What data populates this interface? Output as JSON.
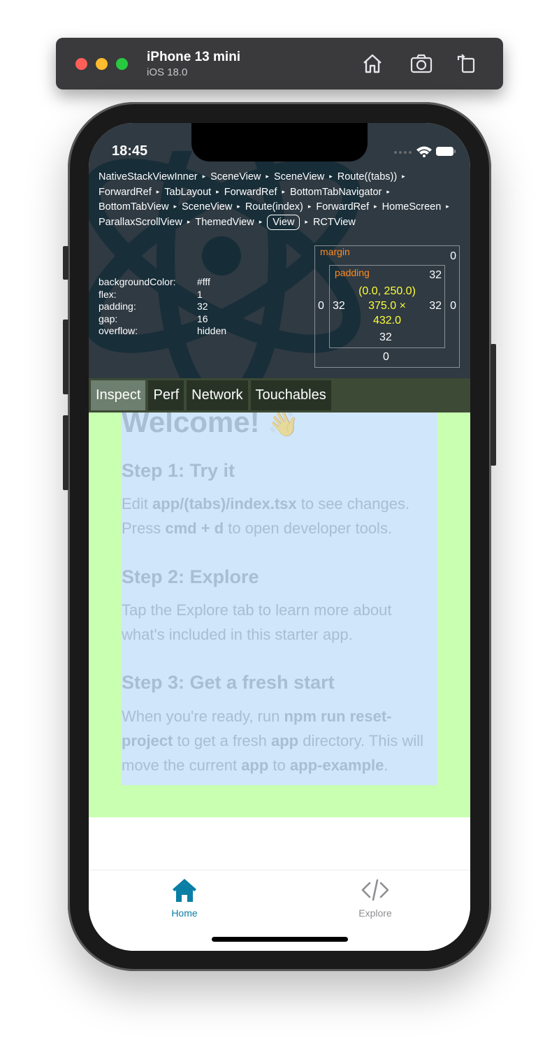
{
  "simulator": {
    "device_name": "iPhone 13 mini",
    "os_version": "iOS 18.0"
  },
  "status_bar": {
    "time": "18:45"
  },
  "inspector": {
    "breadcrumbs": [
      "NativeStackViewInner",
      "SceneView",
      "SceneView",
      "Route((tabs))",
      "ForwardRef",
      "TabLayout",
      "ForwardRef",
      "BottomTabNavigator",
      "BottomTabView",
      "SceneView",
      "Route(index)",
      "ForwardRef",
      "HomeScreen",
      "ParallaxScrollView",
      "ThemedView",
      "View",
      "RCTView"
    ],
    "selected_crumb": "View",
    "props": [
      {
        "key": "backgroundColor:",
        "value": "#fff"
      },
      {
        "key": "flex:",
        "value": "1"
      },
      {
        "key": "padding:",
        "value": "32"
      },
      {
        "key": "gap:",
        "value": "16"
      },
      {
        "key": "overflow:",
        "value": "hidden"
      }
    ],
    "box_model": {
      "margin_label": "margin",
      "padding_label": "padding",
      "margin_top": "0",
      "margin_left": "0",
      "margin_right": "0",
      "margin_bottom": "0",
      "padding_top": "32",
      "padding_left": "32",
      "padding_right": "32",
      "padding_bottom": "32",
      "position": "(0.0, 250.0)",
      "size_line1": "375.0 ×",
      "size_line2": "432.0"
    },
    "tabs": [
      "Inspect",
      "Perf",
      "Network",
      "Touchables"
    ],
    "active_tab": "Inspect"
  },
  "content": {
    "welcome": "Welcome!",
    "wave": "👋",
    "step1_title": "Step 1: Try it",
    "step1_a": "Edit ",
    "step1_b": "app/(tabs)/index.tsx",
    "step1_c": " to see changes. Press ",
    "step1_d": "cmd + d",
    "step1_e": " to open developer tools.",
    "step2_title": "Step 2: Explore",
    "step2_text": "Tap the Explore tab to learn more about what's included in this starter app.",
    "step3_title": "Step 3: Get a fresh start",
    "step3_a": "When you're ready, run ",
    "step3_b": "npm run reset-project",
    "step3_c": " to get a fresh ",
    "step3_d": "app",
    "step3_e": " directory. This will move the current ",
    "step3_f": "app",
    "step3_g": " to ",
    "step3_h": "app-example",
    "step3_i": "."
  },
  "bottom_tabs": [
    {
      "label": "Home",
      "icon": "home-icon",
      "active": true
    },
    {
      "label": "Explore",
      "icon": "code-icon",
      "active": false
    }
  ],
  "colors": {
    "accent": "#0a7ea4",
    "inactive": "#8e8e93",
    "inspector_bg": "#2f3a43",
    "margin_label": "#ff8a1f",
    "dimension_text": "#ffff33",
    "content_bg": "#c8ffb0",
    "content_inner_bg": "#d0e6fb"
  }
}
